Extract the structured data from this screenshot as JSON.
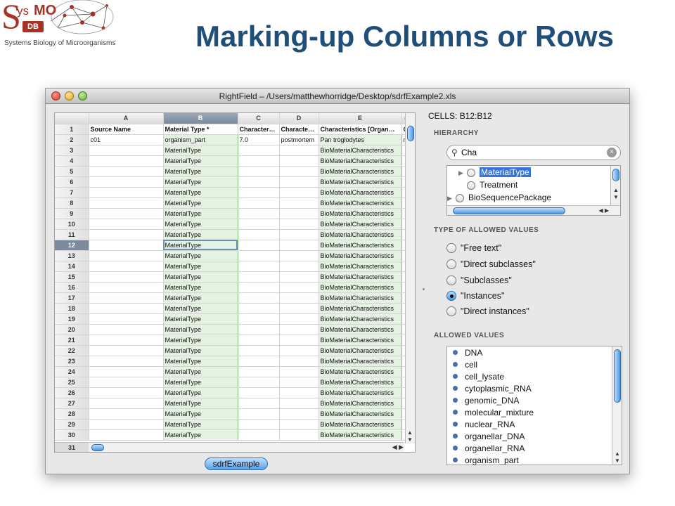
{
  "logo": {
    "s": "S",
    "ys": "ys",
    "mo": "MO",
    "db": "DB",
    "subtitle": "Systems Biology of Microorganisms"
  },
  "slide_title": "Marking-up Columns or Rows",
  "window": {
    "title": "RightField – /Users/matthewhorridge/Desktop/sdrfExample2.xls"
  },
  "sheet": {
    "columns": [
      "A",
      "B",
      "C",
      "D",
      "E",
      "("
    ],
    "selected_column": "B",
    "selected_row": "12",
    "rows": [
      {
        "n": "1",
        "cells": [
          "Source Name",
          "Material Type *",
          "Character…",
          "Characte…",
          "Characteristics [Organ…",
          "C"
        ]
      },
      {
        "n": "2",
        "cells": [
          "c01",
          "organism_part",
          "7.0",
          "postmortem",
          "Pan troglodytes",
          "n"
        ]
      },
      {
        "n": "3",
        "cells": [
          "",
          "MaterialType",
          "",
          "",
          "BioMaterialCharacteristics",
          ""
        ]
      },
      {
        "n": "4",
        "cells": [
          "",
          "MaterialType",
          "",
          "",
          "BioMaterialCharacteristics",
          ""
        ]
      },
      {
        "n": "5",
        "cells": [
          "",
          "MaterialType",
          "",
          "",
          "BioMaterialCharacteristics",
          ""
        ]
      },
      {
        "n": "6",
        "cells": [
          "",
          "MaterialType",
          "",
          "",
          "BioMaterialCharacteristics",
          ""
        ]
      },
      {
        "n": "7",
        "cells": [
          "",
          "MaterialType",
          "",
          "",
          "BioMaterialCharacteristics",
          ""
        ]
      },
      {
        "n": "8",
        "cells": [
          "",
          "MaterialType",
          "",
          "",
          "BioMaterialCharacteristics",
          ""
        ]
      },
      {
        "n": "9",
        "cells": [
          "",
          "MaterialType",
          "",
          "",
          "BioMaterialCharacteristics",
          ""
        ]
      },
      {
        "n": "10",
        "cells": [
          "",
          "MaterialType",
          "",
          "",
          "BioMaterialCharacteristics",
          ""
        ]
      },
      {
        "n": "11",
        "cells": [
          "",
          "MaterialType",
          "",
          "",
          "BioMaterialCharacteristics",
          ""
        ]
      },
      {
        "n": "12",
        "cells": [
          "",
          "MaterialType",
          "",
          "",
          "BioMaterialCharacteristics",
          ""
        ]
      },
      {
        "n": "13",
        "cells": [
          "",
          "MaterialType",
          "",
          "",
          "BioMaterialCharacteristics",
          ""
        ]
      },
      {
        "n": "14",
        "cells": [
          "",
          "MaterialType",
          "",
          "",
          "BioMaterialCharacteristics",
          ""
        ]
      },
      {
        "n": "15",
        "cells": [
          "",
          "MaterialType",
          "",
          "",
          "BioMaterialCharacteristics",
          ""
        ]
      },
      {
        "n": "16",
        "cells": [
          "",
          "MaterialType",
          "",
          "",
          "BioMaterialCharacteristics",
          ""
        ]
      },
      {
        "n": "17",
        "cells": [
          "",
          "MaterialType",
          "",
          "",
          "BioMaterialCharacteristics",
          ""
        ]
      },
      {
        "n": "18",
        "cells": [
          "",
          "MaterialType",
          "",
          "",
          "BioMaterialCharacteristics",
          ""
        ]
      },
      {
        "n": "19",
        "cells": [
          "",
          "MaterialType",
          "",
          "",
          "BioMaterialCharacteristics",
          ""
        ]
      },
      {
        "n": "20",
        "cells": [
          "",
          "MaterialType",
          "",
          "",
          "BioMaterialCharacteristics",
          ""
        ]
      },
      {
        "n": "21",
        "cells": [
          "",
          "MaterialType",
          "",
          "",
          "BioMaterialCharacteristics",
          ""
        ]
      },
      {
        "n": "22",
        "cells": [
          "",
          "MaterialType",
          "",
          "",
          "BioMaterialCharacteristics",
          ""
        ]
      },
      {
        "n": "23",
        "cells": [
          "",
          "MaterialType",
          "",
          "",
          "BioMaterialCharacteristics",
          ""
        ]
      },
      {
        "n": "24",
        "cells": [
          "",
          "MaterialType",
          "",
          "",
          "BioMaterialCharacteristics",
          ""
        ]
      },
      {
        "n": "25",
        "cells": [
          "",
          "MaterialType",
          "",
          "",
          "BioMaterialCharacteristics",
          ""
        ]
      },
      {
        "n": "26",
        "cells": [
          "",
          "MaterialType",
          "",
          "",
          "BioMaterialCharacteristics",
          ""
        ]
      },
      {
        "n": "27",
        "cells": [
          "",
          "MaterialType",
          "",
          "",
          "BioMaterialCharacteristics",
          ""
        ]
      },
      {
        "n": "28",
        "cells": [
          "",
          "MaterialType",
          "",
          "",
          "BioMaterialCharacteristics",
          ""
        ]
      },
      {
        "n": "29",
        "cells": [
          "",
          "MaterialType",
          "",
          "",
          "BioMaterialCharacteristics",
          ""
        ]
      },
      {
        "n": "30",
        "cells": [
          "",
          "MaterialType",
          "",
          "",
          "BioMaterialCharacteristics",
          ""
        ]
      }
    ],
    "last_row": "31",
    "sheet_tab": "sdrfExample"
  },
  "panel": {
    "cells_label": "CELLS: B12:B12",
    "hierarchy_label": "HIERARCHY",
    "search_value": "Cha",
    "tree": [
      {
        "label": "MaterialType",
        "selected": true,
        "expander": true
      },
      {
        "label": "Treatment",
        "selected": false,
        "expander": false
      },
      {
        "label": "BioSequencePackage",
        "selected": false,
        "expander": true
      }
    ],
    "type_label": "TYPE OF ALLOWED VALUES",
    "options": [
      {
        "label": "\"Free text\"",
        "checked": false
      },
      {
        "label": "\"Direct subclasses\"",
        "checked": false
      },
      {
        "label": "\"Subclasses\"",
        "checked": false
      },
      {
        "label": "\"Instances\"",
        "checked": true
      },
      {
        "label": "\"Direct instances\"",
        "checked": false
      }
    ],
    "allowed_label": "ALLOWED VALUES",
    "allowed_values": [
      "DNA",
      "cell",
      "cell_lysate",
      "cytoplasmic_RNA",
      "genomic_DNA",
      "molecular_mixture",
      "nuclear_RNA",
      "organellar_DNA",
      "organellar_RNA",
      "organism_part"
    ]
  },
  "colors": {
    "title_blue": "#1f4e79",
    "logo_red": "#a93226",
    "selection_blue": "#3875d7",
    "column_highlight": "#e4f2e2"
  }
}
